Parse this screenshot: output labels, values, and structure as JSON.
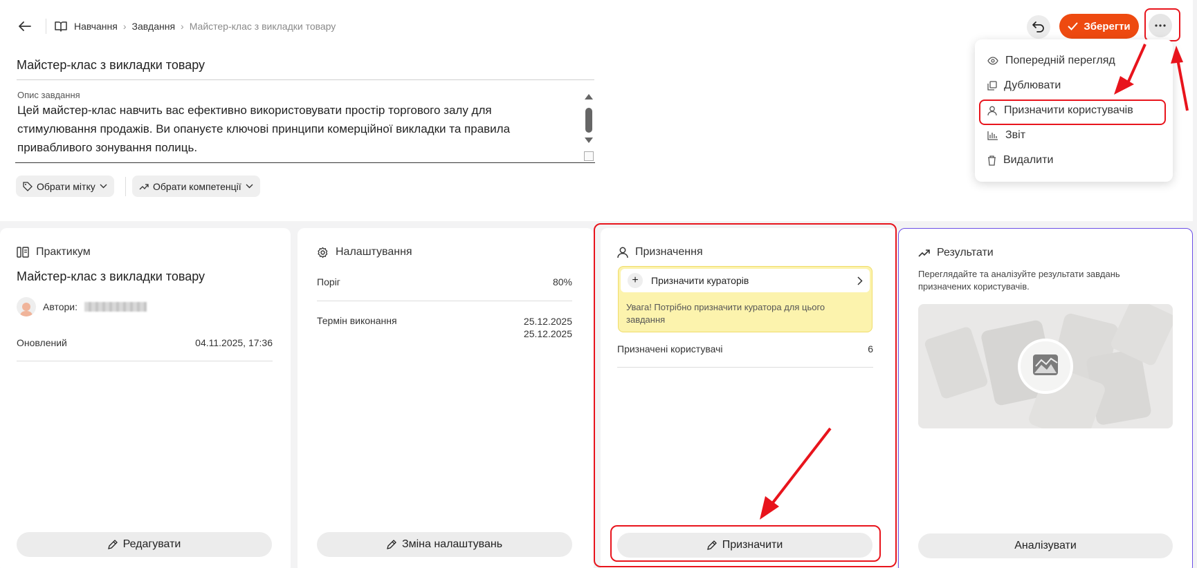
{
  "breadcrumb": {
    "items": [
      "Навчання",
      "Завдання",
      "Майстер-клас з викладки товару"
    ]
  },
  "task": {
    "title": "Майстер-клас з викладки товару",
    "description_label": "Опис завдання",
    "description": "Цей майстер-клас навчить вас ефективно використовувати простір торгового залу для стимулювання продажів. Ви опануєте ключові принципи комерційної викладки та правила привабливого зонування полиць.",
    "tag_button": "Обрати мітку",
    "competence_button": "Обрати компетенції"
  },
  "toolbar": {
    "save_label": "Зберегти"
  },
  "menu": {
    "items": [
      "Попередній перегляд",
      "Дублювати",
      "Призначити користувачів",
      "Звіт",
      "Видалити"
    ]
  },
  "practicum": {
    "heading": "Практикум",
    "title": "Майстер-клас з викладки товару",
    "authors_label": "Автори:",
    "updated_label": "Оновлений",
    "updated_value": "04.11.2025, 17:36",
    "edit_button": "Редагувати"
  },
  "settings": {
    "heading": "Налаштування",
    "threshold_label": "Поріг",
    "threshold_value": "80%",
    "deadline_label": "Термін виконання",
    "deadline_from": "25.12.2025",
    "deadline_to": "25.12.2025",
    "change_button": "Зміна налаштувань"
  },
  "assignment": {
    "heading": "Призначення",
    "assign_curators": "Призначити кураторів",
    "warning": "Увага! Потрібно призначити куратора для цього завдання",
    "assigned_users_label": "Призначені користувачі",
    "assigned_users_count": "6",
    "assign_button": "Призначити"
  },
  "results": {
    "heading": "Результати",
    "description": "Переглядайте та аналізуйте результати завдань призначених користувачів.",
    "analyze_button": "Аналізувати"
  },
  "colors": {
    "accent": "#ee4a10",
    "highlight": "#e8141c",
    "warning_bg": "#fcf3ad"
  }
}
